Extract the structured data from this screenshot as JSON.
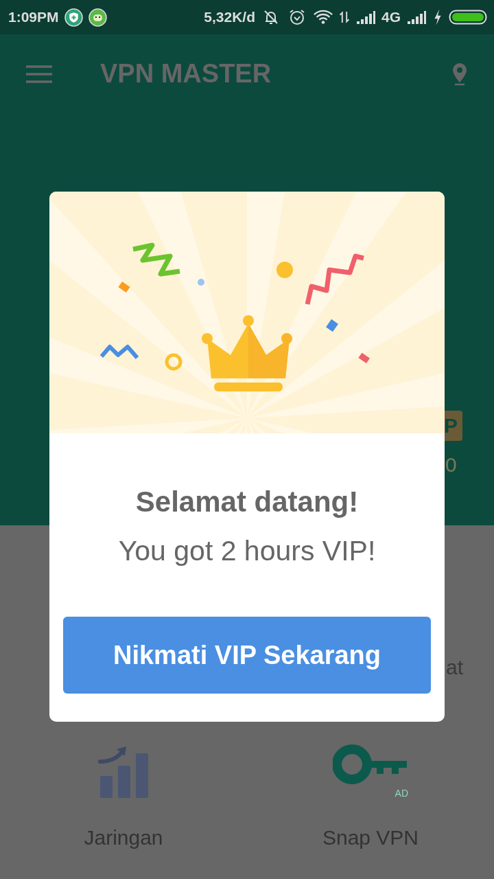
{
  "status_bar": {
    "time": "1:09PM",
    "speed": "5,32K/d",
    "network": "4G"
  },
  "app_bar": {
    "title": "VPN MASTER"
  },
  "background": {
    "badge": "P",
    "counter": "0",
    "label_fragment": "at"
  },
  "dialog": {
    "title": "Selamat datang!",
    "message": "You got 2 hours VIP!",
    "button": "Nikmati VIP Sekarang"
  },
  "features": [
    {
      "kind": "network",
      "label": "Jaringan"
    },
    {
      "kind": "key",
      "label": "Snap VPN",
      "badge": "AD"
    }
  ]
}
